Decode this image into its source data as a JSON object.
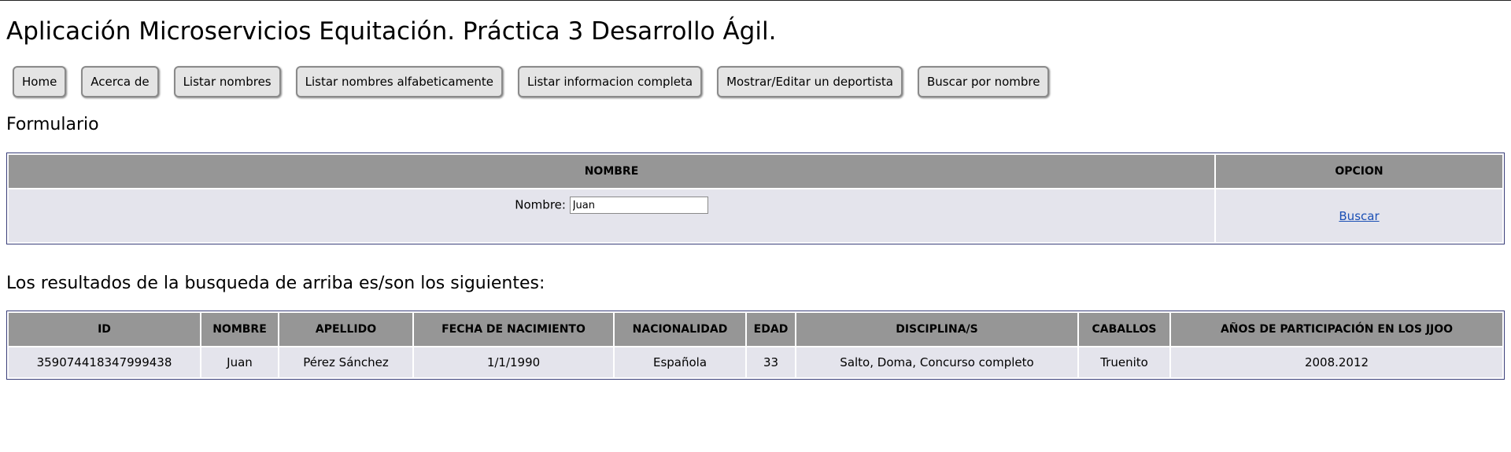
{
  "header": {
    "title": "Aplicación Microservicios Equitación. Práctica 3 Desarrollo Ágil."
  },
  "nav": {
    "items": [
      {
        "label": "Home"
      },
      {
        "label": "Acerca de"
      },
      {
        "label": "Listar nombres"
      },
      {
        "label": "Listar nombres alfabeticamente"
      },
      {
        "label": "Listar informacion completa"
      },
      {
        "label": "Mostrar/Editar un deportista"
      },
      {
        "label": "Buscar por nombre"
      }
    ]
  },
  "form": {
    "heading": "Formulario",
    "col_nombre": "NOMBRE",
    "col_opcion": "OPCION",
    "field_label": "Nombre:",
    "field_value": "Juan",
    "search_link": "Buscar"
  },
  "results": {
    "heading": "Los resultados de la busqueda de arriba es/son los siguientes:",
    "columns": [
      "ID",
      "NOMBRE",
      "APELLIDO",
      "FECHA DE NACIMIENTO",
      "NACIONALIDAD",
      "EDAD",
      "DISCIPLINA/S",
      "CABALLOS",
      "AÑOS DE PARTICIPACIÓN EN LOS JJOO"
    ],
    "rows": [
      [
        "359074418347999438",
        "Juan",
        "Pérez Sánchez",
        "1/1/1990",
        "Española",
        "33",
        "Salto, Doma, Concurso completo",
        "Truenito",
        "2008.2012"
      ]
    ]
  }
}
